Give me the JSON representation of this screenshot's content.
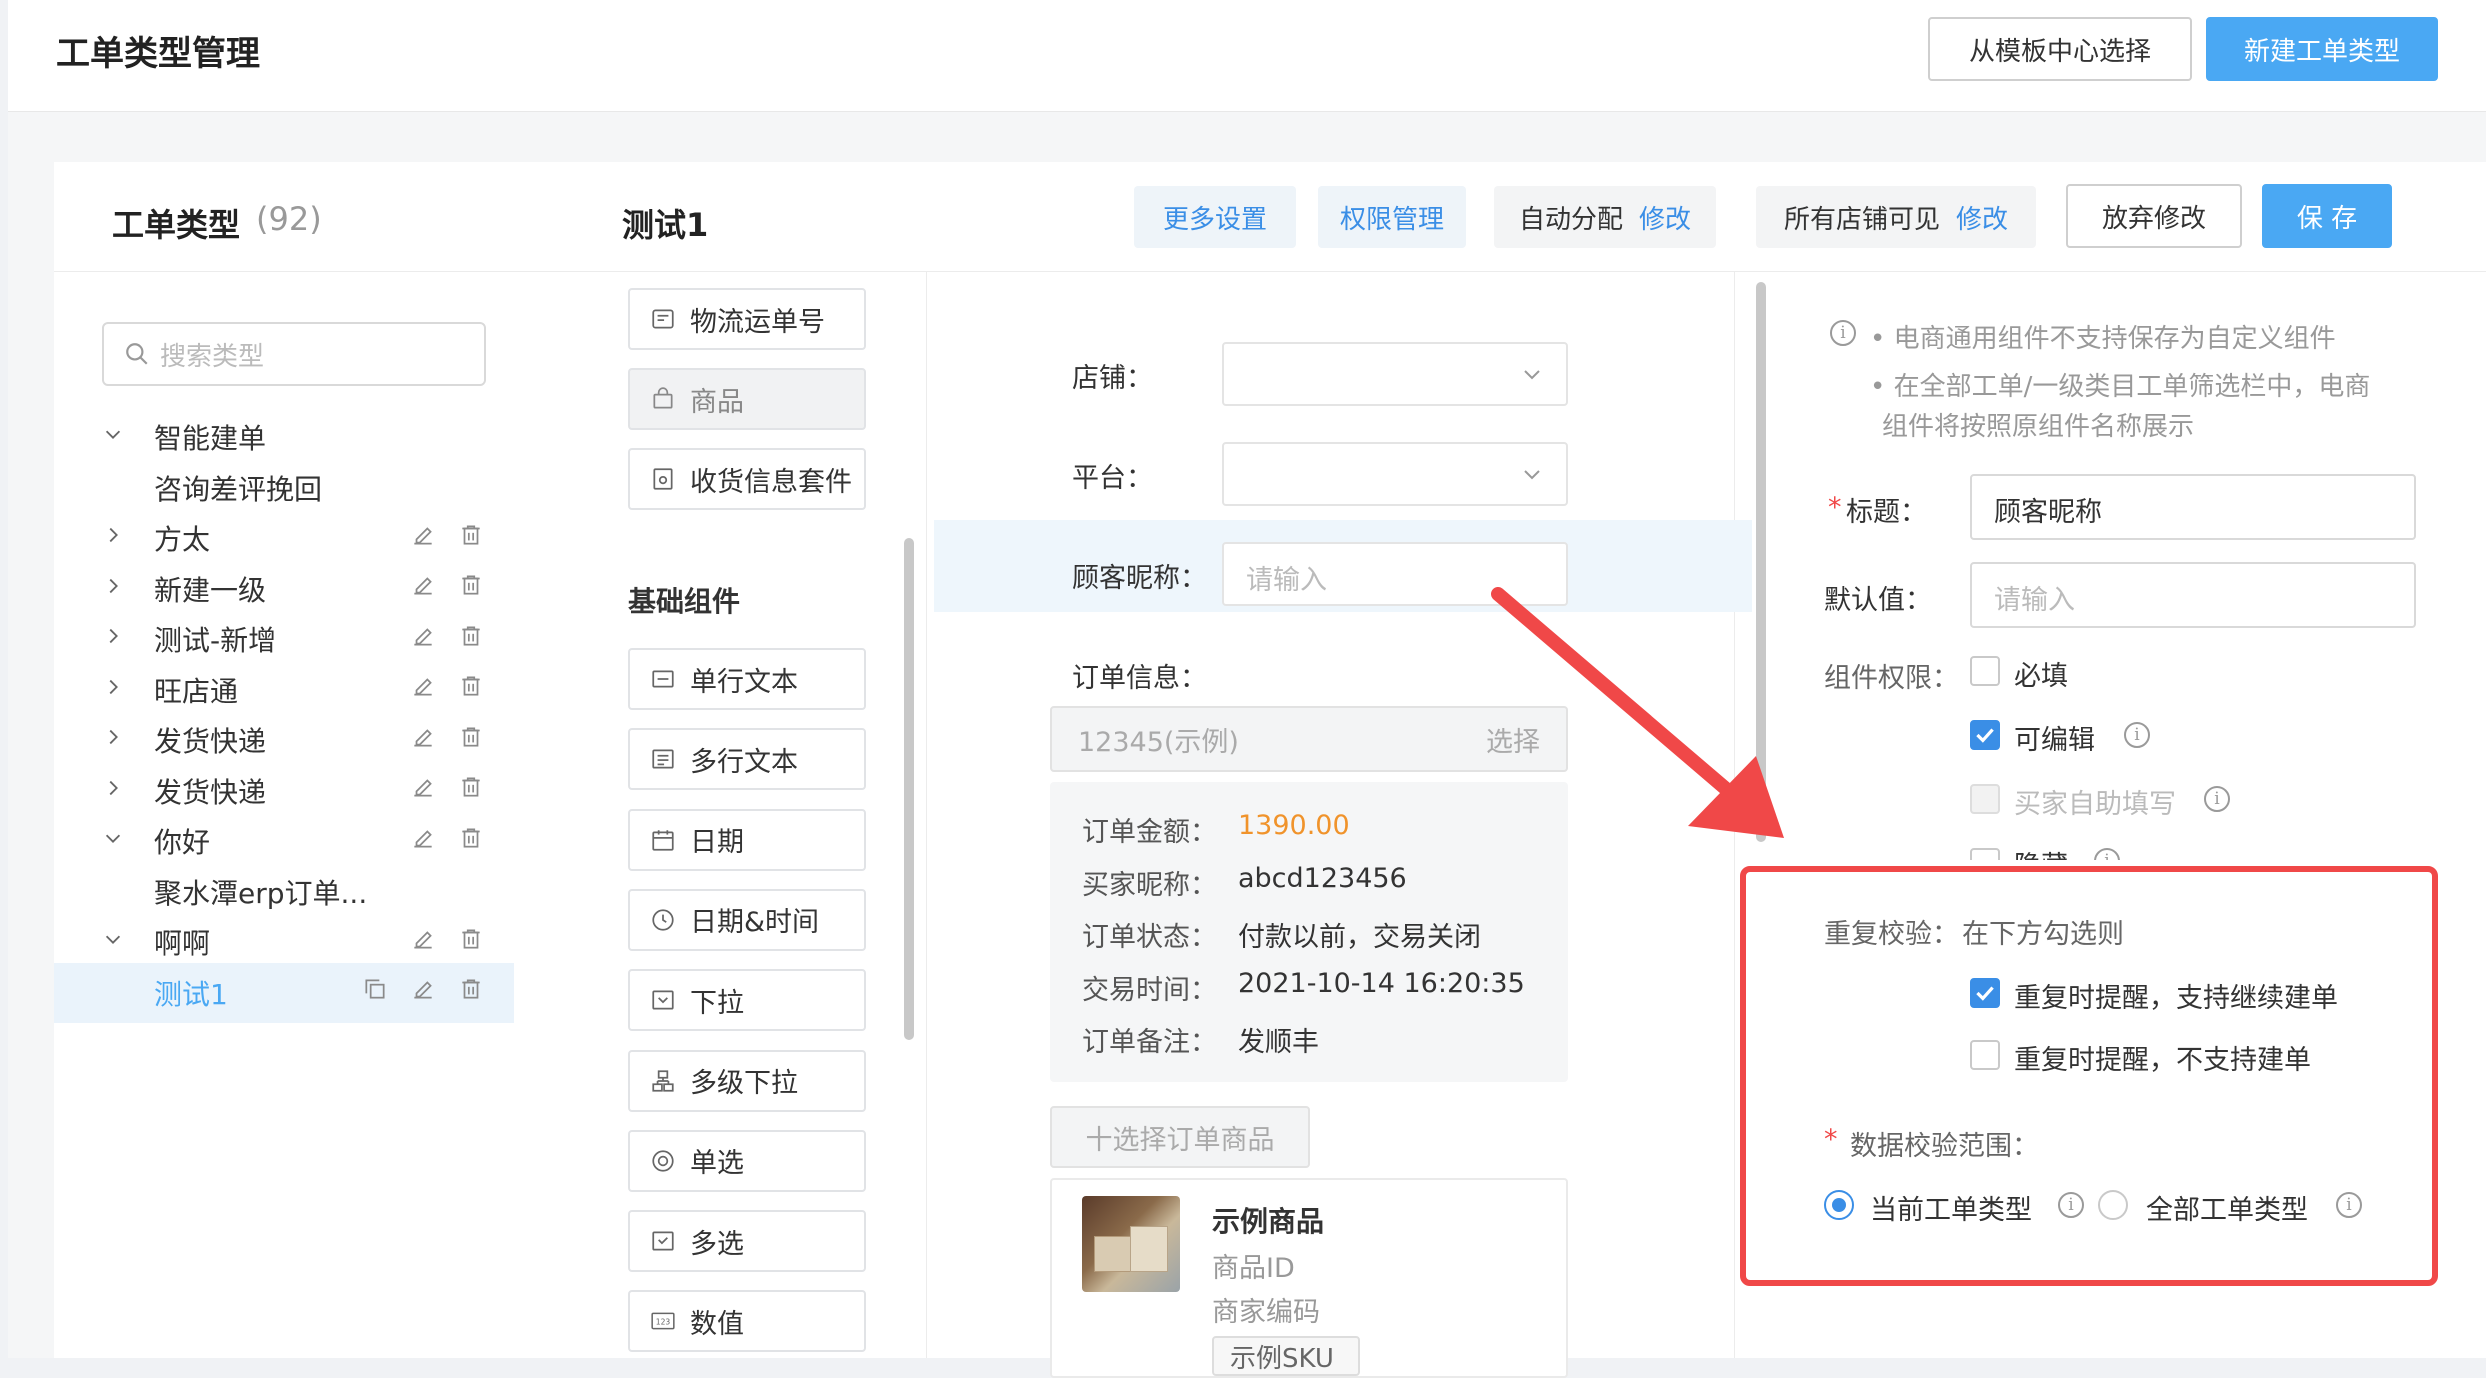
{
  "header": {
    "title": "工单类型管理",
    "template_btn": "从模板中心选择",
    "new_btn": "新建工单类型"
  },
  "list": {
    "title": "工单类型",
    "count": "(92)",
    "search_placeholder": "搜索类型",
    "items": [
      {
        "label": "智能建单",
        "expanded": true,
        "actions": false
      },
      {
        "label": "咨询差评挽回",
        "child": true,
        "actions": false
      },
      {
        "label": "方太",
        "expanded": false,
        "actions": true
      },
      {
        "label": "新建一级",
        "expanded": false,
        "actions": true
      },
      {
        "label": "测试-新增",
        "expanded": false,
        "actions": true
      },
      {
        "label": "旺店通",
        "expanded": false,
        "actions": true
      },
      {
        "label": "发货快递",
        "expanded": false,
        "actions": true
      },
      {
        "label": "发货快递",
        "expanded": false,
        "actions": true
      },
      {
        "label": "你好",
        "expanded": true,
        "actions": true
      },
      {
        "label": "聚水潭erp订单...",
        "child": true,
        "actions": false
      },
      {
        "label": "啊啊",
        "expanded": true,
        "actions": true
      },
      {
        "label": "测试1",
        "child": true,
        "selected": true,
        "actions": true
      }
    ]
  },
  "editor": {
    "name": "测试1",
    "more_settings": "更多设置",
    "permission": "权限管理",
    "auto_assign": "自动分配",
    "modify": "修改",
    "all_shops": "所有店铺可见",
    "discard": "放弃修改",
    "save": "保 存"
  },
  "palette": {
    "ecommerce": [
      {
        "label": "物流运单号",
        "icon": "truck-icon"
      },
      {
        "label": "商品",
        "icon": "bag-icon",
        "disabled": true
      },
      {
        "label": "收货信息套件",
        "icon": "address-icon"
      }
    ],
    "basic_title": "基础组件",
    "basic": [
      {
        "label": "单行文本",
        "icon": "single-line-icon"
      },
      {
        "label": "多行文本",
        "icon": "multi-line-icon"
      },
      {
        "label": "日期",
        "icon": "calendar-icon"
      },
      {
        "label": "日期&时间",
        "icon": "clock-icon"
      },
      {
        "label": "下拉",
        "icon": "dropdown-icon"
      },
      {
        "label": "多级下拉",
        "icon": "cascade-icon"
      },
      {
        "label": "单选",
        "icon": "radio-icon"
      },
      {
        "label": "多选",
        "icon": "checkbox-icon"
      },
      {
        "label": "数值",
        "icon": "number-icon"
      }
    ]
  },
  "form": {
    "shop_label": "店铺：",
    "platform_label": "平台：",
    "nick_label": "顾客昵称：",
    "nick_placeholder": "请输入",
    "order_label": "订单信息：",
    "order_input": "12345(示例)",
    "order_select": "选择",
    "order_rows": [
      {
        "k": "订单金额：",
        "v": "1390.00",
        "accent": true
      },
      {
        "k": "买家昵称：",
        "v": "abcd123456"
      },
      {
        "k": "订单状态：",
        "v": "付款以前，交易关闭"
      },
      {
        "k": "交易时间：",
        "v": "2021-10-14 16:20:35"
      },
      {
        "k": "订单备注：",
        "v": "发顺丰"
      }
    ],
    "add_goods": "十选择订单商品",
    "goods_name": "示例商品",
    "goods_id": "商品ID",
    "goods_code": "商家编码",
    "goods_sku": "示例SKU"
  },
  "props": {
    "notice1": "• 电商通用组件不支持保存为自定义组件",
    "notice2a": "• 在全部工单/一级类目工单筛选栏中，电商",
    "notice2b": "组件将按照原组件名称展示",
    "title_label": "标题：",
    "title_value": "顾客昵称",
    "default_label": "默认值：",
    "default_placeholder": "请输入",
    "perm_label": "组件权限：",
    "perm_required": "必填",
    "perm_editable": "可编辑",
    "perm_buyer": "买家自助填写",
    "perm_hidden": "隐藏",
    "dup_label": "重复校验：",
    "dup_hint": "在下方勾选则",
    "dup_opt1": "重复时提醒，支持继续建单",
    "dup_opt2": "重复时提醒，不支持建单",
    "range_label": "数据校验范围：",
    "range_current": "当前工单类型",
    "range_all": "全部工单类型"
  },
  "colors": {
    "primary": "#4aa8f3",
    "link": "#3a8ee6",
    "accent_amount": "#f0932b",
    "required": "#f04848",
    "annotation_red": "#f04848"
  }
}
